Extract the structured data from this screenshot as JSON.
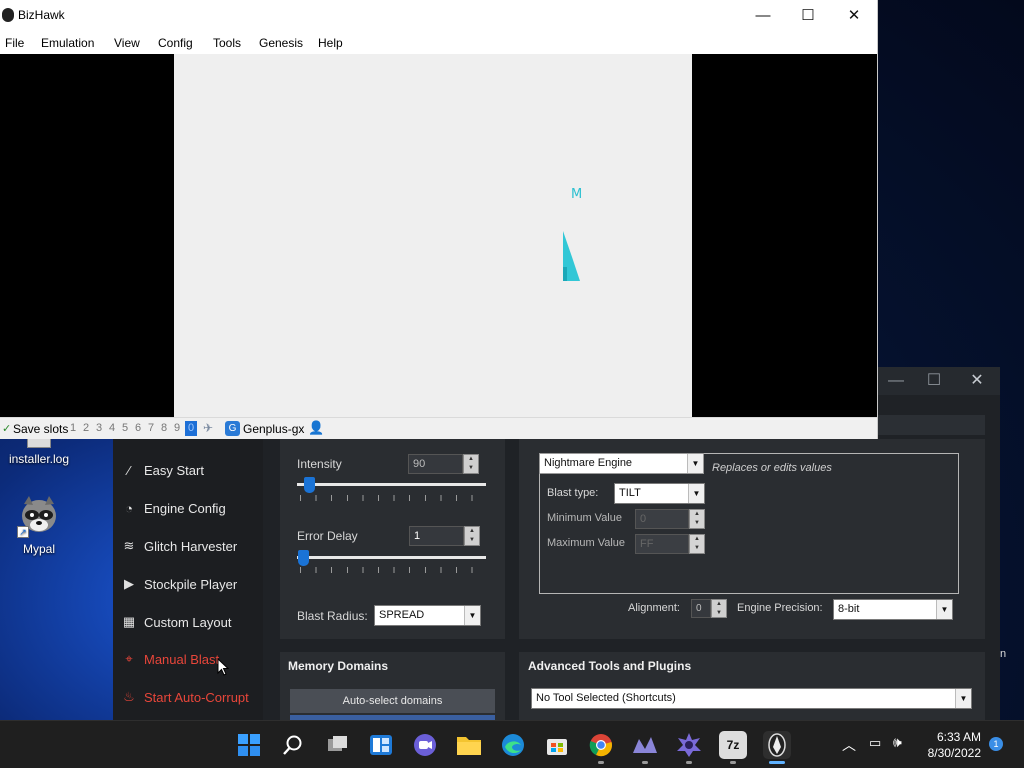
{
  "desktop": {
    "icons": [
      {
        "label": "installer.log"
      },
      {
        "label": "Mypal"
      }
    ],
    "edge_letter": "n"
  },
  "bizhawk": {
    "title": "BizHawk",
    "window_controls": {
      "minimize": "—",
      "maximize": "☐",
      "close": "✕"
    },
    "menu": [
      "File",
      "Emulation",
      "View",
      "Config",
      "Tools",
      "Genesis",
      "Help"
    ],
    "game_glyph": "M",
    "statusbar": {
      "save_slots_label": "Save slots",
      "slots": [
        "1",
        "2",
        "3",
        "4",
        "5",
        "6",
        "7",
        "8",
        "9",
        "0"
      ],
      "active_slot": "0",
      "core": "Genplus-gx"
    }
  },
  "rtc": {
    "sidebar": [
      {
        "label": "Easy Start",
        "icon": "wand-icon",
        "highlight": false
      },
      {
        "label": "Engine Config",
        "icon": "gauge-icon",
        "highlight": false
      },
      {
        "label": "Glitch Harvester",
        "icon": "layers-icon",
        "highlight": false
      },
      {
        "label": "Stockpile Player",
        "icon": "play-icon",
        "highlight": false
      },
      {
        "label": "Custom Layout",
        "icon": "grid-icon",
        "highlight": false
      },
      {
        "label": "Manual Blast",
        "icon": "crosshair-icon",
        "highlight": true
      },
      {
        "label": "Start Auto-Corrupt",
        "icon": "flame-icon",
        "highlight": true
      }
    ],
    "intensity": {
      "label": "Intensity",
      "value": "90",
      "fraction": 0.05
    },
    "error_delay": {
      "label": "Error Delay",
      "value": "1",
      "fraction": 0.0
    },
    "blast_radius": {
      "label": "Blast Radius:",
      "value": "SPREAD"
    },
    "engine": {
      "selected": "Nightmare Engine",
      "description": "Replaces or edits values",
      "blast_type_label": "Blast type:",
      "blast_type": "TILT",
      "min_label": "Minimum Value",
      "min_value": "0",
      "max_label": "Maximum Value",
      "max_value": "FF",
      "alignment_label": "Alignment:",
      "alignment": "0",
      "precision_label": "Engine Precision:",
      "precision": "8-bit"
    },
    "memory_domains": {
      "header": "Memory Domains",
      "autoselect_label": "Auto-select domains"
    },
    "advanced": {
      "header": "Advanced Tools and Plugins",
      "selected": "No Tool Selected (Shortcuts)"
    }
  },
  "taskbar": {
    "apps": [
      "start-icon",
      "search-icon",
      "task-view-icon",
      "widgets-icon",
      "chat-icon",
      "file-explorer-icon",
      "edge-icon",
      "store-icon",
      "chrome-icon",
      "rtc-vanguard-icon",
      "rtc-launcher-icon",
      "7zip-icon",
      "bizhawk-icon"
    ],
    "time": "6:33 AM",
    "date": "8/30/2022",
    "notification_count": "1"
  },
  "colors": {
    "accent": "#1a73d6",
    "danger": "#e8463a",
    "panel": "#2a2d31",
    "taskbar": "#1f1f1f"
  }
}
